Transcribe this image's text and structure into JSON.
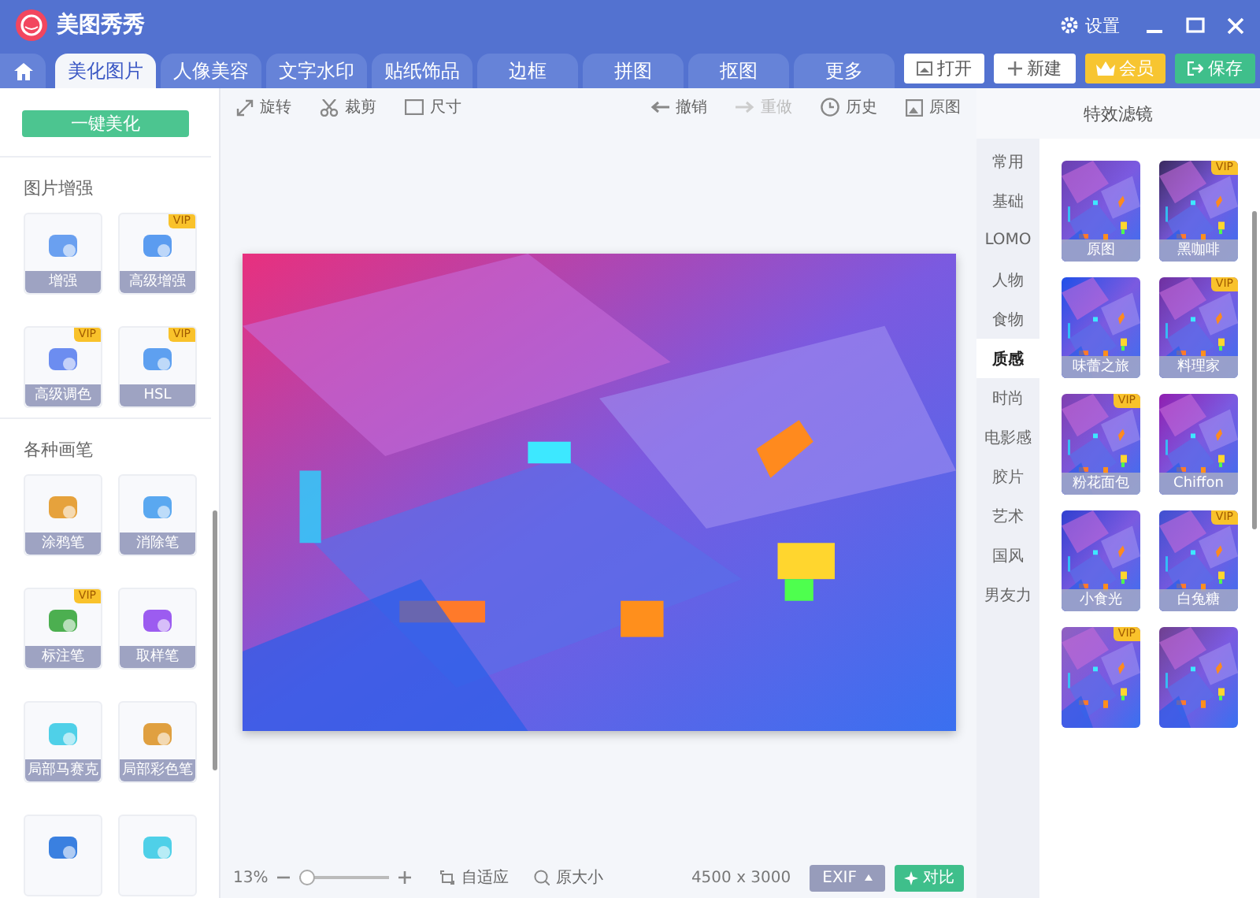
{
  "window": {
    "title": "美图秀秀",
    "settings": "设置"
  },
  "tabs": [
    {
      "label": "美化图片",
      "selected": true
    },
    {
      "label": "人像美容",
      "selected": false
    },
    {
      "label": "文字水印",
      "selected": false
    },
    {
      "label": "贴纸饰品",
      "selected": false
    },
    {
      "label": "边框",
      "selected": false
    },
    {
      "label": "拼图",
      "selected": false
    },
    {
      "label": "抠图",
      "selected": false
    },
    {
      "label": "更多",
      "selected": false
    }
  ],
  "actions": [
    {
      "kind": "open",
      "label": "打开"
    },
    {
      "kind": "new",
      "label": "新建"
    },
    {
      "kind": "vip",
      "label": "会员"
    },
    {
      "kind": "save",
      "label": "保存"
    }
  ],
  "sidebar": {
    "one_click": "一键美化",
    "sections": [
      {
        "title": "图片增强",
        "tools": [
          {
            "kind": "tool",
            "label": "增强"
          },
          {
            "kind": "tool",
            "label": "高级增强",
            "badge": "VIP"
          },
          {
            "kind": "tool",
            "label": "高级调色",
            "badge": "VIP"
          },
          {
            "kind": "tool",
            "label": "HSL",
            "badge": "VIP"
          }
        ]
      },
      {
        "title": "各种画笔",
        "tools": [
          {
            "kind": "tool",
            "label": "涂鸦笔"
          },
          {
            "kind": "tool",
            "label": "消除笔"
          },
          {
            "kind": "tool",
            "label": "标注笔",
            "badge": "VIP"
          },
          {
            "kind": "tool",
            "label": "取样笔"
          },
          {
            "kind": "tool",
            "label": "局部马赛克"
          },
          {
            "kind": "tool",
            "label": "局部彩色笔"
          },
          {
            "kind": "tool"
          },
          {
            "kind": "tool"
          }
        ]
      }
    ]
  },
  "toolbar": {
    "left": [
      {
        "kind": "rotate",
        "label": "旋转"
      },
      {
        "kind": "crop",
        "label": "裁剪"
      },
      {
        "kind": "size",
        "label": "尺寸"
      }
    ],
    "right": [
      {
        "kind": "undo",
        "label": "撤销",
        "disabled": false
      },
      {
        "kind": "redo",
        "label": "重做",
        "disabled": true
      },
      {
        "kind": "history",
        "label": "历史",
        "disabled": false
      },
      {
        "kind": "original",
        "label": "原图",
        "disabled": false
      }
    ]
  },
  "filters": {
    "title": "特效滤镜",
    "categories": [
      {
        "label": "常用",
        "selected": false
      },
      {
        "label": "基础",
        "selected": false
      },
      {
        "label": "LOMO",
        "selected": false
      },
      {
        "label": "人物",
        "selected": false
      },
      {
        "label": "食物",
        "selected": false
      },
      {
        "label": "质感",
        "selected": true
      },
      {
        "label": "时尚",
        "selected": false
      },
      {
        "label": "电影感",
        "selected": false
      },
      {
        "label": "胶片",
        "selected": false
      },
      {
        "label": "艺术",
        "selected": false
      },
      {
        "label": "国风",
        "selected": false
      },
      {
        "label": "男友力",
        "selected": false
      }
    ],
    "items": [
      {
        "kind": "filter",
        "label": "原图"
      },
      {
        "kind": "filter",
        "label": "黑咖啡",
        "badge": "VIP"
      },
      {
        "kind": "filter",
        "label": "味蕾之旅"
      },
      {
        "kind": "filter",
        "label": "料理家",
        "badge": "VIP"
      },
      {
        "kind": "filter",
        "label": "粉花面包",
        "badge": "VIP"
      },
      {
        "kind": "filter",
        "label": "Chiffon"
      },
      {
        "kind": "filter",
        "label": "小食光"
      },
      {
        "kind": "filter",
        "label": "白兔糖",
        "badge": "VIP"
      },
      {
        "kind": "filter",
        "badge": "VIP"
      },
      {
        "kind": "filter"
      }
    ]
  },
  "status_bar": {
    "zoom": "13%",
    "level": 0.08,
    "fit": "自适应",
    "actual_size": "原大小",
    "dimensions": "4500 x 3000",
    "exif": "EXIF",
    "compare": "对比"
  }
}
